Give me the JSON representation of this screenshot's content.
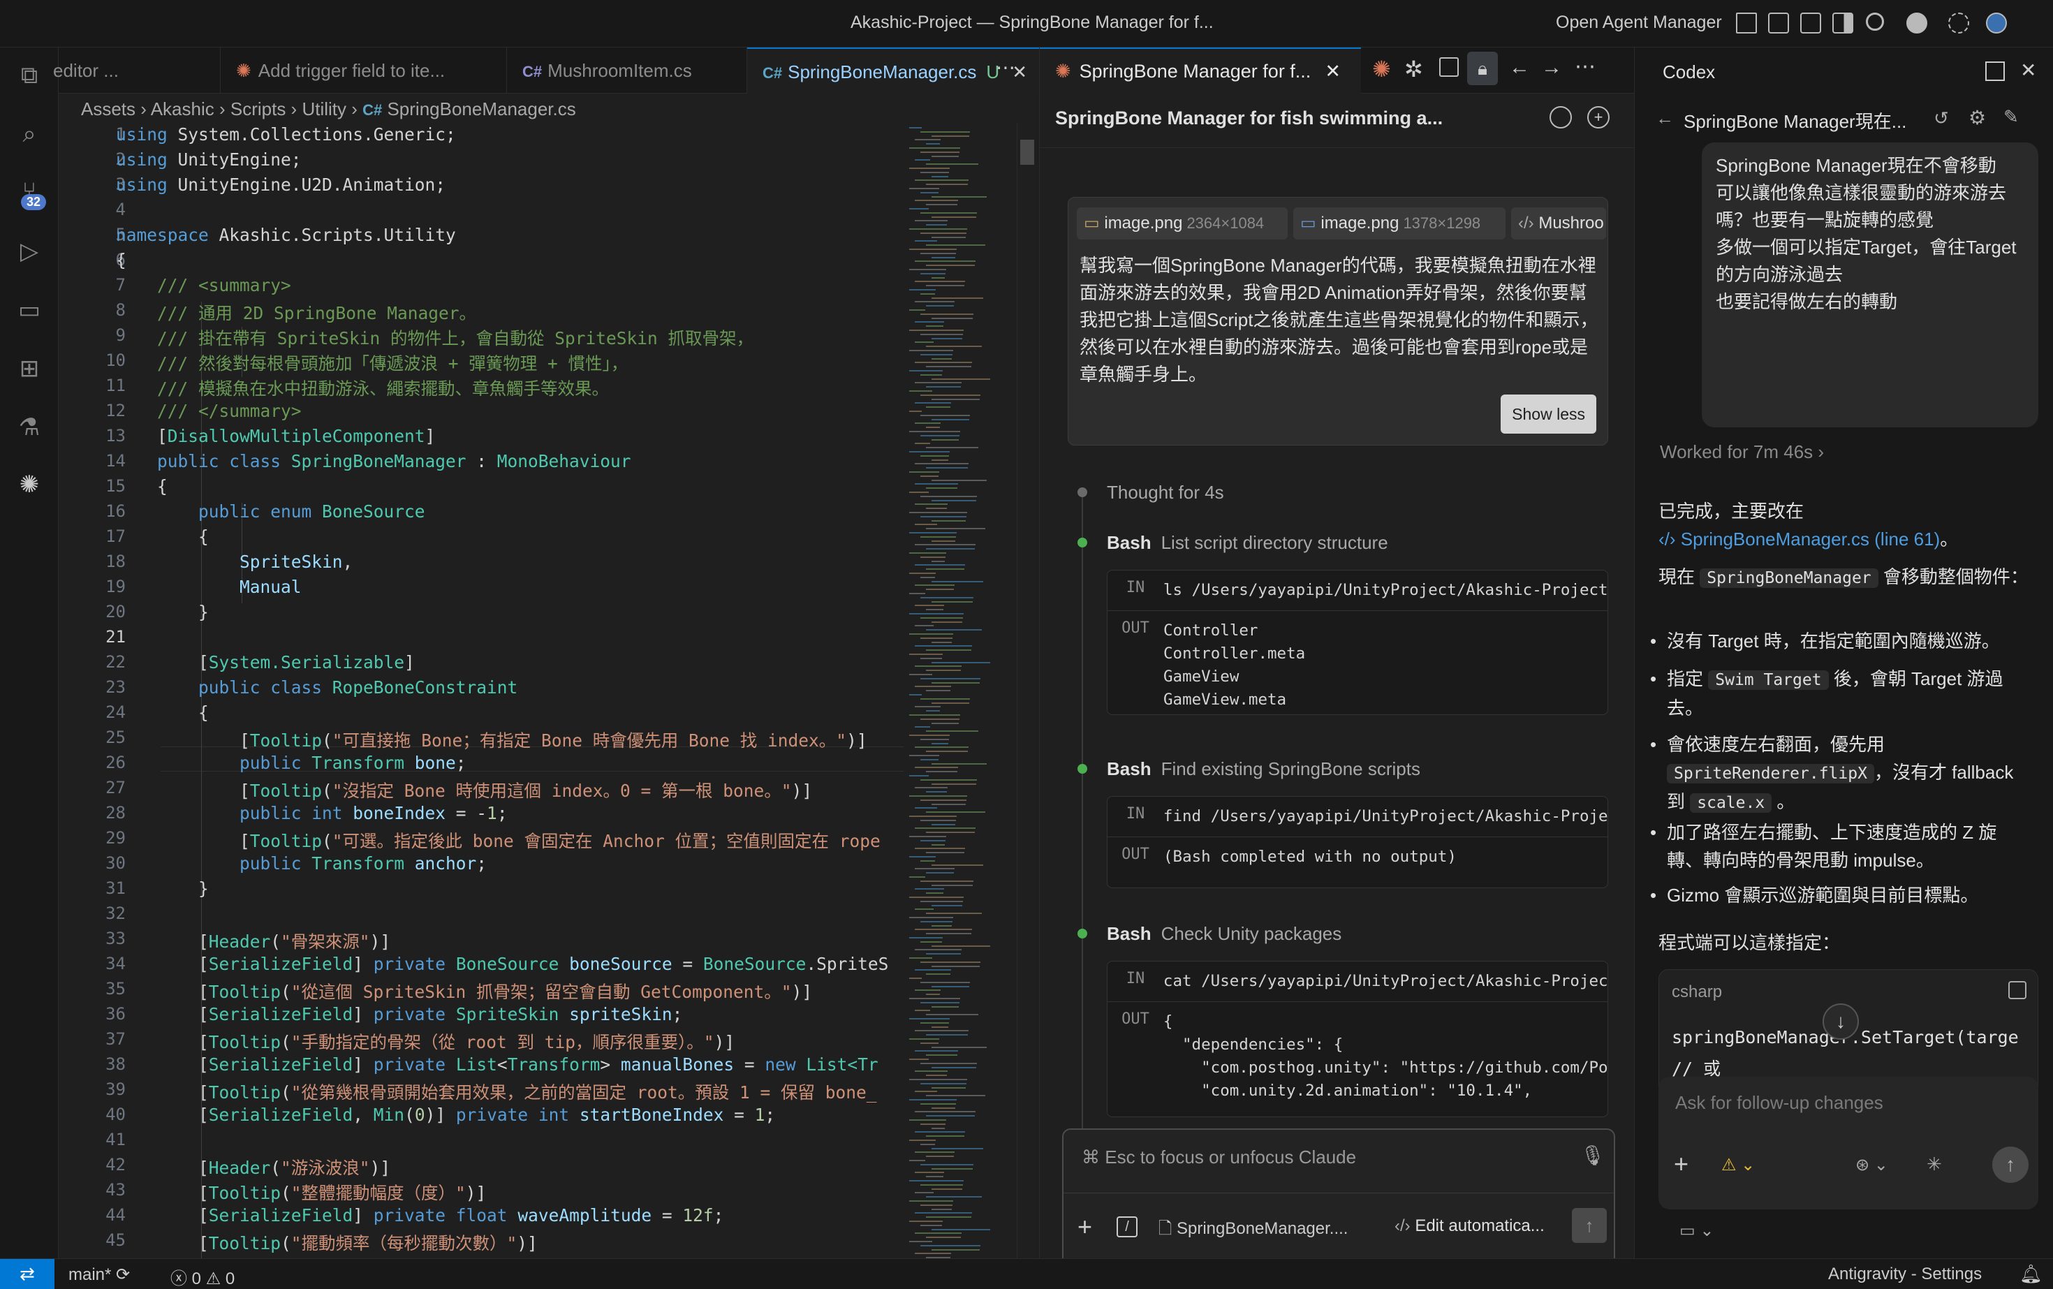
{
  "titlebar": {
    "title": "Akashic-Project — SpringBone Manager for f...",
    "open_agent_manager": "Open Agent Manager"
  },
  "activity": {
    "source_control_badge": "32"
  },
  "editor": {
    "tabs": [
      {
        "label": "editor ...",
        "lang": ""
      },
      {
        "label": "Add trigger field to ite...",
        "lang": ""
      },
      {
        "label": "MushroomItem.cs",
        "lang": "C#"
      },
      {
        "label": "SpringBoneManager.cs",
        "lang": "C#",
        "status": "U"
      }
    ],
    "breadcrumb": [
      "Assets",
      "Akashic",
      "Scripts",
      "Utility",
      "SpringBoneManager.cs"
    ],
    "breadcrumb_lang": "C#"
  },
  "chat": {
    "tab_title": "SpringBone Manager for f...",
    "header_title": "SpringBone Manager for fish swimming a...",
    "attachments": [
      {
        "name": "image.png",
        "dims": "2364×1084"
      },
      {
        "name": "image.png",
        "dims": "1378×1298"
      },
      {
        "name": "Mushroo",
        "dims": ""
      }
    ],
    "user_message": "幫我寫一個SpringBone Manager的代碼，我要模擬魚扭動在水裡面游來游去的效果，我會用2D Animation弄好骨架，然後你要幫我把它掛上這個Script之後就產生這些骨架視覺化的物件和顯示，然後可以在水裡自動的游來游去。過後可能也會套用到rope或是章魚觸手身上。",
    "show_less": "Show less",
    "thought": "Thought for 4s",
    "steps": [
      {
        "tool": "Bash",
        "desc": "List script directory structure",
        "in": "ls /Users/yayapipi/UnityProject/Akashic-Project",
        "out": "Controller\nController.meta\nGameView\nGameView.meta"
      },
      {
        "tool": "Bash",
        "desc": "Find existing SpringBone scripts",
        "in": "find /Users/yayapipi/UnityProject/Akashic-Proje",
        "out": "(Bash completed with no output)"
      },
      {
        "tool": "Bash",
        "desc": "Check Unity packages",
        "in": "cat /Users/yayapipi/UnityProject/Akashic-Projec",
        "out": "{\n  \"dependencies\": {\n    \"com.posthog.unity\": \"https://github.com/Po\n    \"com.unity.2d.animation\": \"10.1.4\","
      }
    ],
    "io_in": "IN",
    "io_out": "OUT",
    "input_placeholder": "⌘ Esc to focus or unfocus Claude",
    "context_file": "SpringBoneManager....",
    "edit_mode": "Edit automatica..."
  },
  "codex": {
    "title": "Codex",
    "thread_title": "SpringBone Manager現在...",
    "user_bubble": [
      "SpringBone Manager現在不會移動",
      "可以讓他像魚這樣很靈動的游來游去嗎？也要有一點旋轉的感覺",
      "多做一個可以指定Target，會往Target的方向游泳過去",
      "也要記得做左右的轉動"
    ],
    "worked_for": "Worked for 7m 46s",
    "done_text": "已完成，主要改在",
    "file_link": "SpringBoneManager.cs (line 61)",
    "period": "。",
    "now_prefix": "現在",
    "now_class": "SpringBoneManager",
    "now_suffix": "會移動整個物件：",
    "bullets": [
      {
        "a": "沒有 Target 時，在指定範圍內隨機巡游。"
      },
      {
        "a": "指定",
        "code": "Swim Target",
        "b": "後，會朝 Target 游過去。"
      },
      {
        "a": "會依速度左右翻面，優先用",
        "code": "SpriteRenderer.flipX",
        "b": "，沒有才 fallback 到",
        "code2": "scale.x",
        "c": "。"
      },
      {
        "a": "加了路徑左右擺動、上下速度造成的 Z 旋轉、轉向時的骨架甩動 impulse。"
      },
      {
        "a": "Gizmo 會顯示巡游範圍與目前目標點。"
      }
    ],
    "program_hint": "程式端可以這樣指定：",
    "code_lang": "csharp",
    "code_line1": "springBoneManager.SetTarget(targe",
    "code_line2": "// 或",
    "input_placeholder": "Ask for follow-up changes"
  },
  "status": {
    "branch": "main*",
    "errors": "0",
    "warnings": "0",
    "right": "Antigravity - Settings"
  }
}
